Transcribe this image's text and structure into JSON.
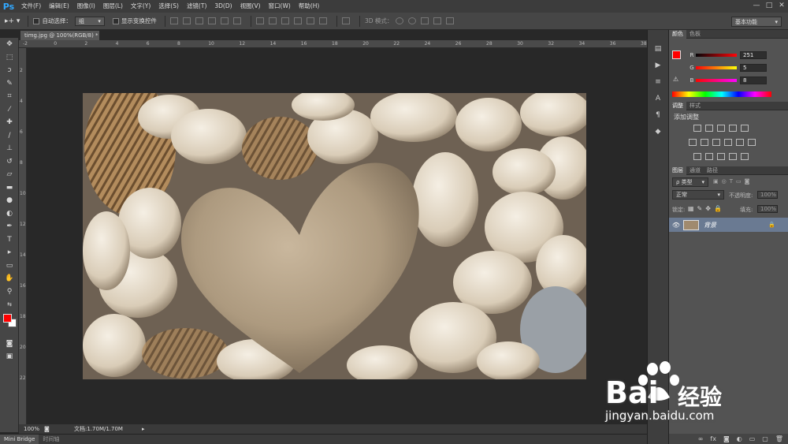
{
  "app": {
    "logo": "Ps"
  },
  "menu": [
    "文件(F)",
    "编辑(E)",
    "图像(I)",
    "图层(L)",
    "文字(Y)",
    "选择(S)",
    "滤镜(T)",
    "3D(D)",
    "视图(V)",
    "窗口(W)",
    "帮助(H)"
  ],
  "window_controls": [
    "—",
    "□",
    "✕"
  ],
  "options": {
    "auto_select_label": "自动选择：",
    "auto_select_value": "组",
    "show_transform_label": "显示变换控件",
    "mode_3d_label": "3D 模式：",
    "workspace": "基本功能"
  },
  "document": {
    "tab_title": "timg.jpg @ 100%(RGB/8) *",
    "zoom": "100%",
    "doc_info": "文档:1.70M/1.70M"
  },
  "ruler_h_labels": [
    "-2",
    "0",
    "2",
    "4",
    "6",
    "8",
    "10",
    "12",
    "14",
    "16",
    "18",
    "20",
    "22",
    "24",
    "26",
    "28",
    "30",
    "32",
    "34",
    "36",
    "38"
  ],
  "ruler_v_labels": [
    "2",
    "4",
    "6",
    "8",
    "10",
    "12",
    "14",
    "16",
    "18",
    "20",
    "22"
  ],
  "bottom_tabs": [
    "Mini Bridge",
    "时间轴"
  ],
  "color_panel": {
    "tabs": [
      "颜色",
      "色板"
    ],
    "r_label": "R",
    "r_value": "251",
    "g_label": "G",
    "g_value": "5",
    "b_label": "B",
    "b_value": "8",
    "fg_color": "#fb0508"
  },
  "adjust_panel": {
    "tabs": [
      "调整",
      "样式"
    ],
    "title": "添加调整"
  },
  "layers_panel": {
    "tabs": [
      "图层",
      "通道",
      "路径"
    ],
    "filter_kind": "ρ 类型",
    "blend_mode": "正常",
    "opacity_label": "不透明度:",
    "opacity_value": "100%",
    "lock_label": "锁定:",
    "fill_label": "填充:",
    "fill_value": "100%",
    "layer_name": "背景"
  },
  "watermark": {
    "brand": "Bai",
    "brand_cn": "经验",
    "url": "jingyan.baidu.com"
  }
}
